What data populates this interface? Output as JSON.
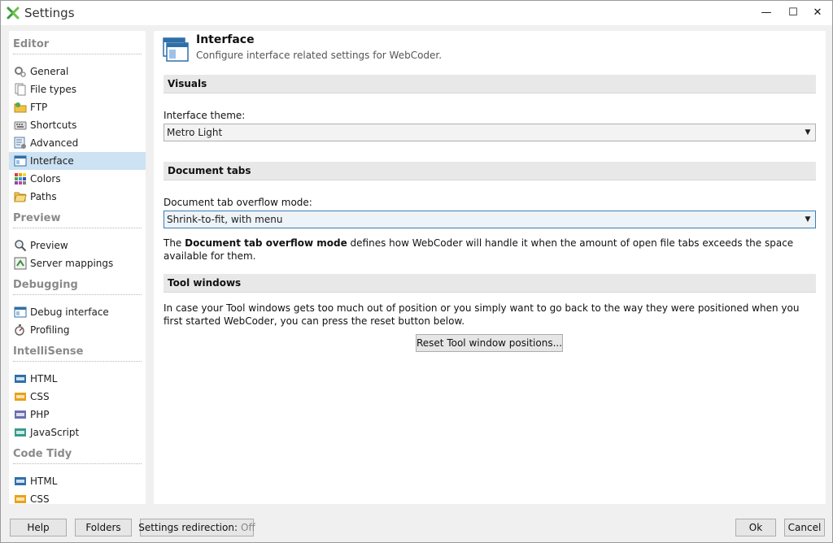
{
  "window": {
    "title": "Settings",
    "controls": {
      "minimize": "—",
      "maximize": "☐",
      "close": "✕"
    }
  },
  "sidebar": {
    "sections": [
      {
        "title": "Editor",
        "items": [
          {
            "label": "General",
            "icon": "gears-icon"
          },
          {
            "label": "File types",
            "icon": "file-types-icon"
          },
          {
            "label": "FTP",
            "icon": "ftp-folder-icon"
          },
          {
            "label": "Shortcuts",
            "icon": "keyboard-icon"
          },
          {
            "label": "Advanced",
            "icon": "advanced-icon"
          },
          {
            "label": "Interface",
            "icon": "window-icon",
            "selected": true
          },
          {
            "label": "Colors",
            "icon": "color-grid-icon"
          },
          {
            "label": "Paths",
            "icon": "folders-icon"
          }
        ]
      },
      {
        "title": "Preview",
        "items": [
          {
            "label": "Preview",
            "icon": "magnifier-icon"
          },
          {
            "label": "Server mappings",
            "icon": "server-mapping-icon"
          }
        ]
      },
      {
        "title": "Debugging",
        "items": [
          {
            "label": "Debug interface",
            "icon": "debug-window-icon"
          },
          {
            "label": "Profiling",
            "icon": "profiling-icon"
          }
        ]
      },
      {
        "title": "IntelliSense",
        "items": [
          {
            "label": "HTML",
            "icon": "html-icon"
          },
          {
            "label": "CSS",
            "icon": "css-icon"
          },
          {
            "label": "PHP",
            "icon": "php-icon"
          },
          {
            "label": "JavaScript",
            "icon": "javascript-icon"
          }
        ]
      },
      {
        "title": "Code Tidy",
        "items": [
          {
            "label": "HTML",
            "icon": "html-icon"
          },
          {
            "label": "CSS",
            "icon": "css-icon"
          }
        ]
      }
    ]
  },
  "main": {
    "title": "Interface",
    "subtitle": "Configure interface related settings for WebCoder.",
    "visuals": {
      "heading": "Visuals",
      "theme_label": "Interface theme:",
      "theme_value": "Metro Light"
    },
    "document_tabs": {
      "heading": "Document tabs",
      "overflow_label": "Document tab overflow mode:",
      "overflow_value": "Shrink-to-fit, with menu",
      "desc_pre": "The ",
      "desc_bold": "Document tab overflow mode",
      "desc_post": " defines how WebCoder will handle it when the amount of open file tabs exceeds the space available for them."
    },
    "tool_windows": {
      "heading": "Tool windows",
      "desc": "In case your Tool windows gets too much out of position or you simply want to go back to the way they were positioned when you first started WebCoder, you can press the reset button below.",
      "reset_label": "Reset Tool window positions..."
    }
  },
  "footer": {
    "help": "Help",
    "folders": "Folders",
    "redirection_label": "Settings redirection:",
    "redirection_value": "Off",
    "ok": "Ok",
    "cancel": "Cancel"
  }
}
